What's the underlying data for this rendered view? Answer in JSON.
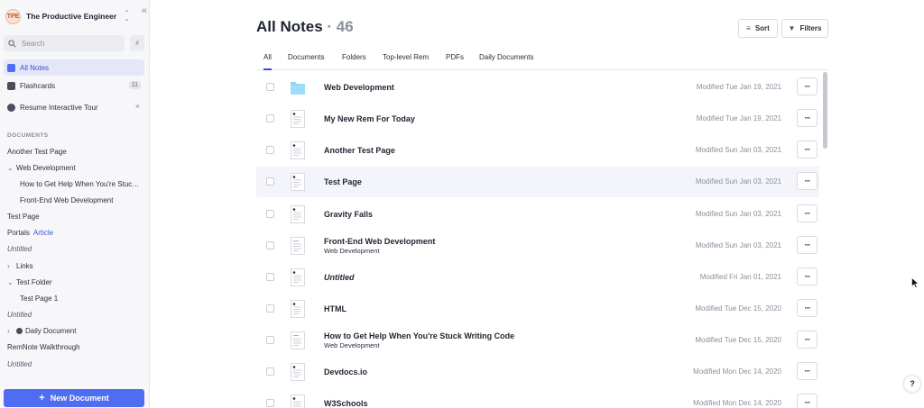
{
  "workspace": {
    "name": "The Productive Engineer",
    "logo_text": "TPE"
  },
  "search": {
    "placeholder": "Search"
  },
  "nav": {
    "all_notes": "All Notes",
    "flashcards": "Flashcards",
    "flashcards_count": "11",
    "tour": "Resume Interactive Tour"
  },
  "sidebar": {
    "section_title": "DOCUMENTS",
    "docs": [
      {
        "label": "Another Test Page"
      },
      {
        "label": "Web Development",
        "chevron": "⌄"
      },
      {
        "label": "How to Get Help When You're Stuck Writing Code"
      },
      {
        "label": "Front-End Web Development"
      },
      {
        "label": "Test Page"
      },
      {
        "label": "Portals",
        "link": "Article"
      },
      {
        "label": "Untitled"
      },
      {
        "label": "Links",
        "chevron": "›"
      },
      {
        "label": "Test Folder",
        "chevron": "⌄"
      },
      {
        "label": "Test Page 1"
      },
      {
        "label": "Untitled"
      },
      {
        "label": "Daily Document",
        "chevron": "›"
      },
      {
        "label": "RemNote Walkthrough"
      },
      {
        "label": "Untitled"
      }
    ],
    "new_document": "New Document"
  },
  "main": {
    "title": "All Notes",
    "count": "· 46",
    "sort_label": "Sort",
    "filters_label": "Filters",
    "tabs": [
      "All",
      "Documents",
      "Folders",
      "Top-level Rem",
      "PDFs",
      "Daily Documents"
    ],
    "rows": [
      {
        "name": "Web Development",
        "modified": "Modified Tue Jan 19, 2021",
        "icon": "folder-icon"
      },
      {
        "name": "My New Rem For Today",
        "modified": "Modified Tue Jan 19, 2021",
        "icon": "document-icon"
      },
      {
        "name": "Another Test Page",
        "modified": "Modified Sun Jan 03, 2021",
        "icon": "document-icon"
      },
      {
        "name": "Test Page",
        "modified": "Modified Sun Jan 03, 2021",
        "icon": "document-icon"
      },
      {
        "name": "Gravity Falls",
        "modified": "Modified Sun Jan 03, 2021",
        "icon": "document-icon"
      },
      {
        "name": "Front-End Web Development",
        "sub": "Web Development",
        "modified": "Modified Sun Jan 03, 2021",
        "icon": "page-icon"
      },
      {
        "name": "Untitled",
        "modified": "Modified Fri Jan 01, 2021",
        "icon": "document-icon"
      },
      {
        "name": "HTML",
        "modified": "Modified Tue Dec 15, 2020",
        "icon": "document-icon"
      },
      {
        "name": "How to Get Help When You're Stuck Writing Code",
        "sub": "Web Development",
        "modified": "Modified Tue Dec 15, 2020",
        "icon": "page-icon"
      },
      {
        "name": "Devdocs.io",
        "modified": "Modified Mon Dec 14, 2020",
        "icon": "document-icon"
      },
      {
        "name": "W3Schools",
        "modified": "Modified Mon Dec 14, 2020",
        "icon": "document-icon"
      }
    ],
    "more_label": "···"
  },
  "help": {
    "label": "?"
  },
  "colors": {
    "accent": "#4f6df0",
    "active_bg": "#e3e7f8",
    "folder": "#8fd3f4"
  }
}
